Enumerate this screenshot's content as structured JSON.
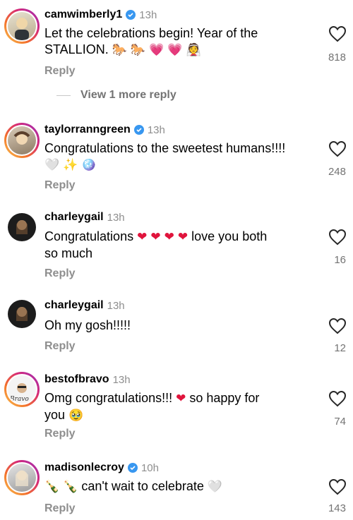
{
  "comments": [
    {
      "username": "camwimberly1",
      "verified": true,
      "time": "13h",
      "text_parts": [
        "Let the celebrations begin! Year of the",
        "STALLION. "
      ],
      "emojis": [
        "🐎",
        "🐎",
        "💗",
        "💗",
        "👰"
      ],
      "likes": "818",
      "reply_label": "Reply",
      "view_replies_label": "View 1 more reply",
      "avatar_icon": "profile-photo"
    },
    {
      "username": "taylorranngreen",
      "verified": true,
      "time": "13h",
      "text": "Congratulations to the sweetest humans!!!!",
      "emojis": [
        "🤍",
        "✨",
        "🪩"
      ],
      "likes": "248",
      "reply_label": "Reply",
      "avatar_icon": "profile-photo"
    },
    {
      "username": "charleygail",
      "verified": false,
      "time": "13h",
      "text_before": "Congratulations ",
      "emojis": [
        "❤",
        "❤",
        "❤",
        "❤"
      ],
      "text_after": " love you both",
      "text_line2": "so much",
      "likes": "16",
      "reply_label": "Reply",
      "avatar_icon": "profile-photo"
    },
    {
      "username": "charleygail",
      "verified": false,
      "time": "13h",
      "text": "Oh my gosh!!!!!",
      "likes": "12",
      "reply_label": "Reply",
      "avatar_icon": "profile-photo"
    },
    {
      "username": "bestofbravo",
      "verified": false,
      "time": "13h",
      "text_before": "Omg congratulations!!! ",
      "emojis": [
        "❤",
        "🥹"
      ],
      "text_after": " so happy for",
      "text_line2": "you ",
      "likes": "74",
      "reply_label": "Reply",
      "avatar_icon": "bravo-logo"
    },
    {
      "username": "madisonlecroy",
      "verified": true,
      "time": "10h",
      "emojis": [
        "🍾",
        "🍾",
        "🤍"
      ],
      "text": " can't wait to celebrate ",
      "likes": "143",
      "reply_label": "Reply",
      "avatar_icon": "profile-photo"
    }
  ],
  "colors": {
    "secondary_text": "#8e8e8e",
    "verified_blue": "#3897f0",
    "ring_gradient": [
      "#f9c74f",
      "#f3722c",
      "#d62976",
      "#962fbf"
    ],
    "heart_red": "#e0143c"
  }
}
